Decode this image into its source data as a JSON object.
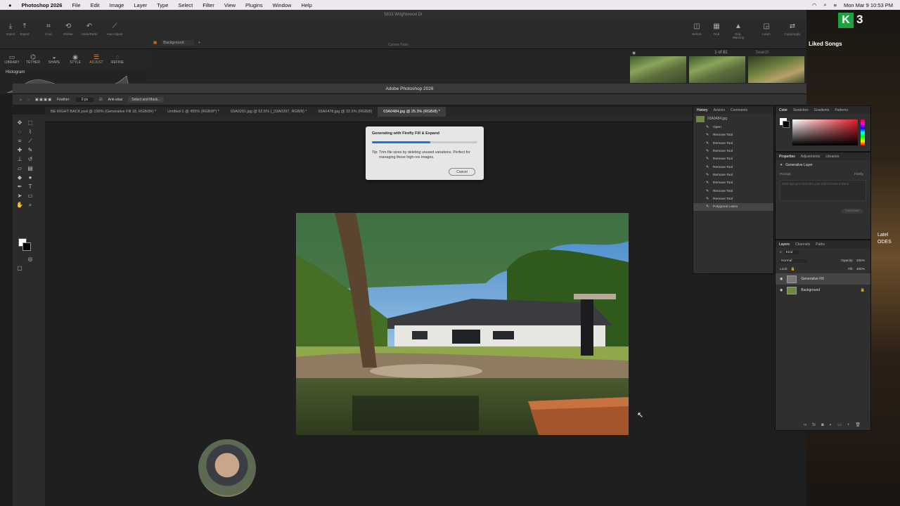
{
  "menubar": {
    "apple": "",
    "app": "Photoshop 2026",
    "items": [
      "File",
      "Edit",
      "Image",
      "Layer",
      "Type",
      "Select",
      "Filter",
      "View",
      "Plugins",
      "Window",
      "Help"
    ],
    "datetime": "Mon Mar 9  10:53 PM"
  },
  "back_window": {
    "title": "5833 Wrightwood Dr",
    "toolbar": [
      "Import",
      "Export",
      "Crop",
      "Rotate",
      "Undo/Redo",
      "Auto Adjust"
    ],
    "toolbar_right": [
      "Before",
      "Grid",
      "Exp. Warning",
      "Learn",
      "Copy/Apply"
    ],
    "center_label": "Curves Tools",
    "tabs": [
      "LIBRARY",
      "TETHER",
      "SHAPE",
      "STYLE",
      "ADJUST",
      "REFINE"
    ],
    "active_tab": "ADJUST",
    "layer_select": "Background",
    "histogram_label": "Histogram",
    "counter": "1 of 81",
    "search_placeholder": "Search"
  },
  "music": {
    "badge": "K",
    "badge_num": "3",
    "playlist": "Liked Songs",
    "side_text": [
      "Latel",
      "ODES"
    ]
  },
  "ps": {
    "title": "Adobe Photoshop 2026",
    "options": {
      "feather_label": "Feather:",
      "feather_value": "0 px",
      "anti_alias": "Anti-alias",
      "select_mask": "Select and Mask..."
    },
    "doc_tabs": [
      "BE RIGHT BACK.psd @ 100% (Generative Fill 18, RGB/8#) *",
      "Untitled-1 @ 455% (RGB/8*) *",
      "03A0291.jpg @ 52.5% (_03A0297, RGB/8) *",
      "03A0478.jpg @ 32.5% (RGB/8)",
      "03A0484.jpg @ 25.3% (RGB/8) *"
    ],
    "active_doc_tab": 4
  },
  "dialog": {
    "title": "Generating with Firefly Fill & Expand",
    "progress": 0.55,
    "tip_label": "Tip:",
    "tip": "Trim file sizes by deleting unused variations. Perfect for managing those high-res images.",
    "cancel": "Cancel"
  },
  "history_panel": {
    "tabs": [
      "History",
      "Actions",
      "Comments"
    ],
    "snapshot": "03A0484.jpg",
    "items": [
      "Open",
      "Remove Tool",
      "Remove Tool",
      "Remove Tool",
      "Remove Tool",
      "Remove Tool",
      "Remove Tool",
      "Remove Tool",
      "Remove Tool",
      "Remove Tool",
      "Polygonal Lasso"
    ],
    "selected_index": 10
  },
  "color_panel": {
    "tabs": [
      "Color",
      "Swatches",
      "Gradients",
      "Patterns"
    ],
    "fg_color": "#ffffff",
    "bg_color": "#000000"
  },
  "properties_panel": {
    "tabs": [
      "Properties",
      "Adjustments",
      "Libraries"
    ],
    "layer_type": "Generative Layer",
    "prompt_label": "Prompt",
    "model": "Firefly",
    "prompt_placeholder": "Start typing to describe your edit or leave it blank",
    "generate": "Generate"
  },
  "layers_panel": {
    "tabs": [
      "Layers",
      "Channels",
      "Paths"
    ],
    "kind": "Kind",
    "blend": "Normal",
    "opacity_label": "Opacity:",
    "opacity": "100%",
    "lock_label": "Lock:",
    "fill_label": "Fill:",
    "fill": "100%",
    "layers": [
      "Generative Fill",
      "Background"
    ],
    "selected_index": 0
  },
  "icons": {
    "apple": "apple-icon",
    "move": "move-tool-icon",
    "marquee": "marquee-tool-icon",
    "lasso": "lasso-tool-icon",
    "eye": "eye-icon",
    "lock": "lock-icon"
  }
}
